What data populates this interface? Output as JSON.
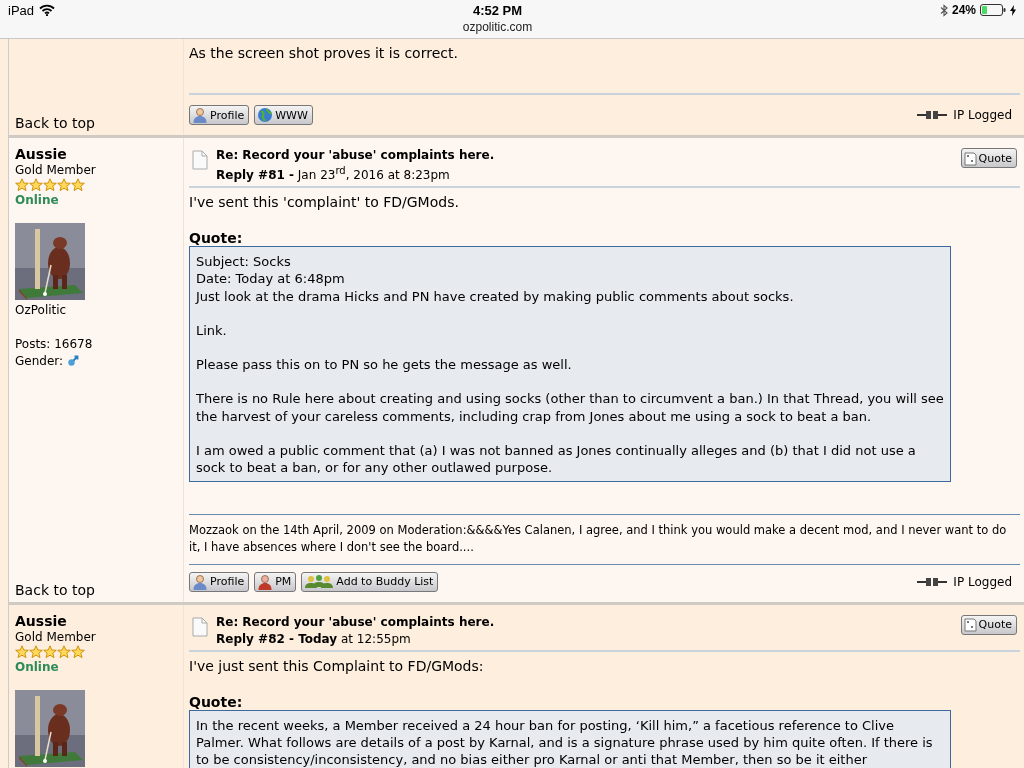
{
  "status_bar": {
    "device": "iPad",
    "time": "4:52 PM",
    "url": "ozpolitic.com",
    "battery": "24%"
  },
  "posts": [
    {
      "shaded": true,
      "body": [
        "As the screen shot proves it is correct."
      ],
      "buttons": [
        {
          "kind": "profile",
          "label": "Profile"
        },
        {
          "kind": "www",
          "label": "WWW"
        }
      ],
      "back_to_top": "Back to top",
      "ip_logged": "IP Logged"
    },
    {
      "shaded": false,
      "author": "Aussie",
      "rank": "Gold Member",
      "stars": 5,
      "status": "Online",
      "avatar": {
        "kind": "picture"
      },
      "site": "OzPolitic",
      "posts": "Posts: 16678",
      "gender": "Gender:",
      "title": "Re: Record your 'abuse' complaints here.",
      "reply": "**Reply #81 -** Jan 23$^{rd}$, 2016 at 8:23pm",
      "quote_button": "Quote",
      "body": [
        "I've sent this 'complaint' to FD/GMods."
      ],
      "quote_heading": "Quote:",
      "quote": [
        [
          "Subject: Socks",
          "Date: Today at 6:48pm",
          "Just look at the drama Hicks and PN have created by making public comments about socks."
        ],
        [
          "Link."
        ],
        [
          "Please pass this on to PN so he gets the message as well."
        ],
        [
          "There is no Rule here about creating and using socks (other than to circumvent a ban.)  In that Thread, you will see the harvest of your careless comments, including crap from Jones about me using a sock to beat a ban."
        ],
        [
          "I am owed a public comment that (a) I was not banned as Jones continually alleges and (b) that I did not use a sock to beat a ban, or for any other outlawed purpose."
        ]
      ],
      "signature": "Mozzaok on the 14th April, 2009 on Moderation:&&&&Yes Calanen, I agree, and I think you would make a decent mod, and I never want to do it, I have absences where I don't see the board....",
      "buttons": [
        {
          "kind": "profile",
          "label": "Profile"
        },
        {
          "kind": "pm",
          "label": "PM"
        },
        {
          "kind": "buddy",
          "label": "Add to Buddy List"
        }
      ],
      "back_to_top": "Back to top",
      "ip_logged": "IP Logged"
    },
    {
      "shaded": true,
      "author": "Aussie",
      "rank": "Gold Member",
      "stars": 5,
      "status": "Online",
      "avatar": {
        "kind": "picture"
      },
      "title": "Re: Record your 'abuse' complaints here.",
      "reply": "**Reply #82 - Today** at 12:55pm",
      "quote_button": "Quote",
      "body": [
        "I've just sent this Complaint to FD/GMods:"
      ],
      "quote_heading": "Quote:",
      "quote": [
        [
          "In the recent weeks, a Member received a 24 hour ban for posting, ‘Kill him,” a facetious reference to Clive Palmer.  What follows are details of a post by Karnal, and is a signature phrase used by him  quite often.   If there is to be consistency/inconsistency,  and no bias either pro Karnal or anti that Member, then so be it either"
        ]
      ]
    }
  ]
}
